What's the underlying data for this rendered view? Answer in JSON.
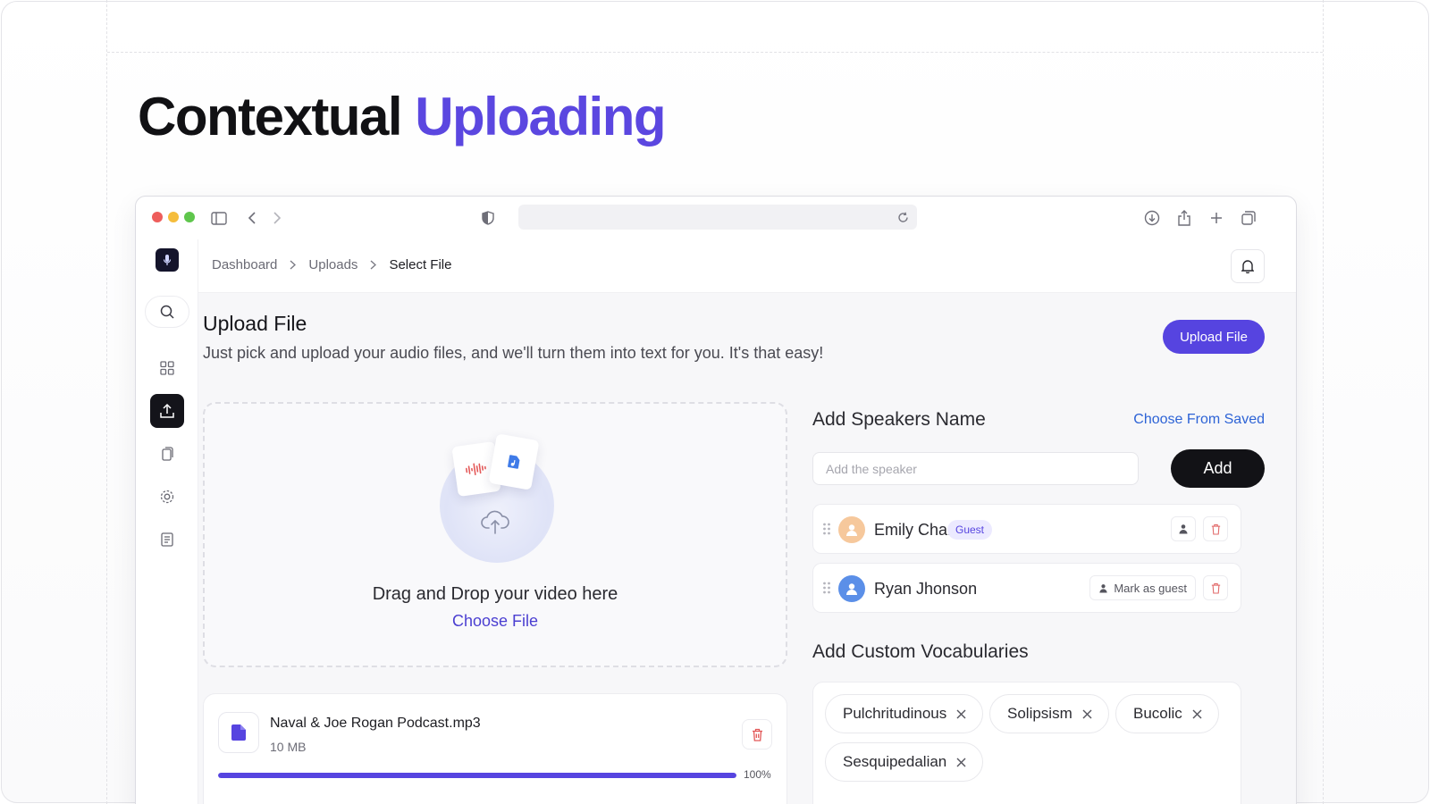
{
  "hero": {
    "title_plain": "Contextual",
    "title_accent": "Uploading"
  },
  "colors": {
    "accent": "#5644e0",
    "link": "#2d63d6",
    "danger": "#e25757",
    "dark": "#121216"
  },
  "browser": {
    "traffic_lights": [
      "#ee5d5b",
      "#f5bd3c",
      "#5fc64c"
    ],
    "toolbar_icons": [
      "sidebar-toggle-icon",
      "back-icon",
      "forward-icon",
      "shield-icon",
      "reload-icon",
      "download-icon",
      "share-icon",
      "plus-icon",
      "tabs-icon"
    ]
  },
  "sidebar": {
    "items": [
      {
        "name": "search-icon"
      },
      {
        "name": "dashboard-grid-icon"
      },
      {
        "name": "upload-icon",
        "active": true
      },
      {
        "name": "files-icon"
      },
      {
        "name": "record-icon"
      },
      {
        "name": "document-icon"
      }
    ]
  },
  "breadcrumb": [
    "Dashboard",
    "Uploads",
    "Select File"
  ],
  "page": {
    "title": "Upload File",
    "subtitle": "Just pick and upload your audio files, and we'll turn them into text for you. It's that easy!",
    "upload_button": "Upload File"
  },
  "dropzone": {
    "text": "Drag and Drop your video here",
    "choose": "Choose File"
  },
  "file": {
    "name": "Naval & Joe Rogan Podcast.mp3",
    "size": "10 MB",
    "progress": 1.0,
    "progress_label": "100%"
  },
  "speakers": {
    "title": "Add Speakers Name",
    "choose_saved": "Choose From Saved",
    "placeholder": "Add the speaker",
    "add_label": "Add",
    "list": [
      {
        "name": "Emily Chang",
        "badge": "Guest",
        "avatar_color": "#f6c89c"
      },
      {
        "name": "Ryan Jhonson",
        "action": "Mark as guest",
        "avatar_color": "#5b8fe8"
      }
    ]
  },
  "vocab": {
    "title": "Add Custom Vocabularies",
    "chips": [
      "Pulchritudinous",
      "Solipsism",
      "Bucolic",
      "Sesquipedalian"
    ]
  }
}
